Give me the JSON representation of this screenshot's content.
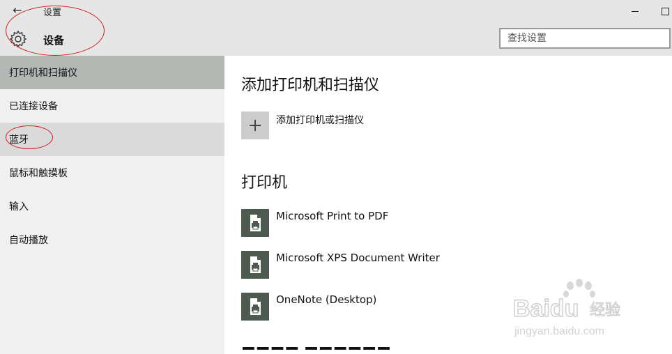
{
  "window": {
    "app_title": "设置",
    "back_icon": "back-arrow-icon",
    "minimize_icon": "minimize-icon",
    "maximize_icon": "maximize-icon"
  },
  "header": {
    "icon": "gear-icon",
    "title": "设备"
  },
  "search": {
    "placeholder": "查找设置",
    "value": ""
  },
  "sidebar": {
    "items": [
      {
        "label": "打印机和扫描仪"
      },
      {
        "label": "已连接设备"
      },
      {
        "label": "蓝牙"
      },
      {
        "label": "鼠标和触摸板"
      },
      {
        "label": "输入"
      },
      {
        "label": "自动播放"
      }
    ],
    "selected": "打印机和扫描仪"
  },
  "main": {
    "section_add": {
      "title": "添加打印机和扫描仪",
      "add_button_label": "添加打印机或扫描仪",
      "add_icon": "plus-icon"
    },
    "section_printers": {
      "title": "打印机",
      "printer_icon": "printer-icon",
      "printers": [
        {
          "name": "Microsoft Print to PDF"
        },
        {
          "name": "Microsoft XPS Document Writer"
        },
        {
          "name": "OneNote (Desktop)"
        }
      ]
    }
  },
  "watermark": {
    "brand": "Baidu",
    "brand_suffix": "经验",
    "url": "jingyan.baidu.com"
  },
  "colors": {
    "titlebar_bg": "#e6e6e6",
    "sidebar_bg": "#f0f0f0",
    "sidebar_selected": "#b4b8b4",
    "sidebar_hover": "#dadada",
    "printer_tile": "#4c5a4f",
    "annotation_red": "#d41a1a"
  }
}
